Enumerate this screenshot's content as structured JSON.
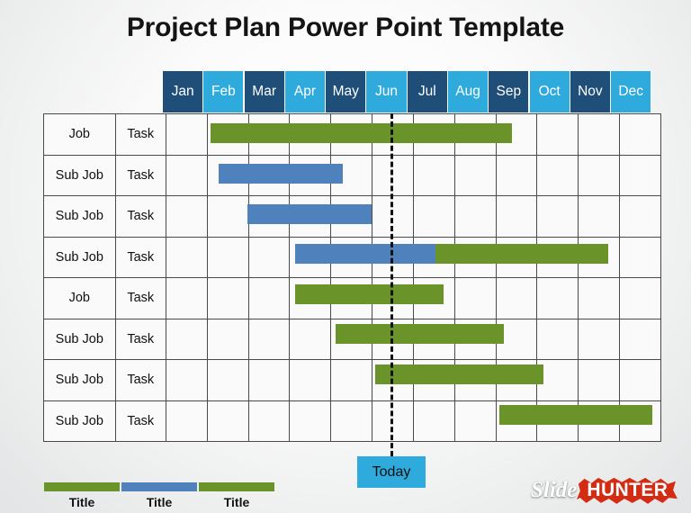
{
  "title": "Project Plan Power Point Template",
  "colors": {
    "month_dark": "#1F4E79",
    "month_light": "#2EAADC",
    "bar_green": "#6A9429",
    "bar_blue": "#4F81BD",
    "today_box": "#2EAADC",
    "logo_red": "#D32C13"
  },
  "months": [
    {
      "label": "Jan",
      "tone": "dark"
    },
    {
      "label": "Feb",
      "tone": "light"
    },
    {
      "label": "Mar",
      "tone": "dark"
    },
    {
      "label": "Apr",
      "tone": "light"
    },
    {
      "label": "May",
      "tone": "dark"
    },
    {
      "label": "Jun",
      "tone": "light"
    },
    {
      "label": "Jul",
      "tone": "dark"
    },
    {
      "label": "Aug",
      "tone": "light"
    },
    {
      "label": "Sep",
      "tone": "dark"
    },
    {
      "label": "Oct",
      "tone": "light"
    },
    {
      "label": "Nov",
      "tone": "dark"
    },
    {
      "label": "Dec",
      "tone": "light"
    }
  ],
  "rows": [
    {
      "job": "Job",
      "task": "Task"
    },
    {
      "job": "Sub Job",
      "task": "Task"
    },
    {
      "job": "Sub Job",
      "task": "Task"
    },
    {
      "job": "Sub Job",
      "task": "Task"
    },
    {
      "job": "Job",
      "task": "Task"
    },
    {
      "job": "Sub Job",
      "task": "Task"
    },
    {
      "job": "Sub Job",
      "task": "Task"
    },
    {
      "job": "Sub Job",
      "task": "Task"
    }
  ],
  "today": {
    "label": "Today",
    "month_index": 6
  },
  "legend": [
    {
      "label": "Title",
      "color": "green"
    },
    {
      "label": "Title",
      "color": "blue"
    },
    {
      "label": "Title",
      "color": "green"
    }
  ],
  "logo": {
    "word_one": "Slide",
    "word_two": "HUNTER"
  },
  "chart_data": {
    "type": "bar",
    "title": "Project Plan Power Point Template",
    "xlabel": "",
    "ylabel": "",
    "categories": [
      "Jan",
      "Feb",
      "Mar",
      "Apr",
      "May",
      "Jun",
      "Jul",
      "Aug",
      "Sep",
      "Oct",
      "Nov",
      "Dec"
    ],
    "grid": true,
    "legend_position": "bottom-left",
    "today_marker_month": "Jun/Jul boundary",
    "tasks": [
      {
        "row": 1,
        "job": "Job",
        "task": "Task",
        "segments": [
          {
            "color": "green",
            "start_month": 2.2,
            "end_month": 9.7
          }
        ]
      },
      {
        "row": 2,
        "job": "Sub Job",
        "task": "Task",
        "segments": [
          {
            "color": "blue",
            "start_month": 2.4,
            "end_month": 5.5
          }
        ]
      },
      {
        "row": 3,
        "job": "Sub Job",
        "task": "Task",
        "segments": [
          {
            "color": "blue",
            "start_month": 3.1,
            "end_month": 6.2
          }
        ]
      },
      {
        "row": 4,
        "job": "Sub Job",
        "task": "Task",
        "segments": [
          {
            "color": "blue",
            "start_month": 4.3,
            "end_month": 7.8
          },
          {
            "color": "green",
            "start_month": 7.8,
            "end_month": 12.1
          }
        ]
      },
      {
        "row": 5,
        "job": "Job",
        "task": "Task",
        "segments": [
          {
            "color": "green",
            "start_month": 4.3,
            "end_month": 8.0
          }
        ]
      },
      {
        "row": 6,
        "job": "Sub Job",
        "task": "Task",
        "segments": [
          {
            "color": "green",
            "start_month": 5.3,
            "end_month": 9.5
          }
        ]
      },
      {
        "row": 7,
        "job": "Sub Job",
        "task": "Task",
        "segments": [
          {
            "color": "green",
            "start_month": 6.3,
            "end_month": 10.5
          }
        ]
      },
      {
        "row": 8,
        "job": "Sub Job",
        "task": "Task",
        "segments": [
          {
            "color": "green",
            "start_month": 9.4,
            "end_month": 13.2
          }
        ]
      }
    ]
  }
}
